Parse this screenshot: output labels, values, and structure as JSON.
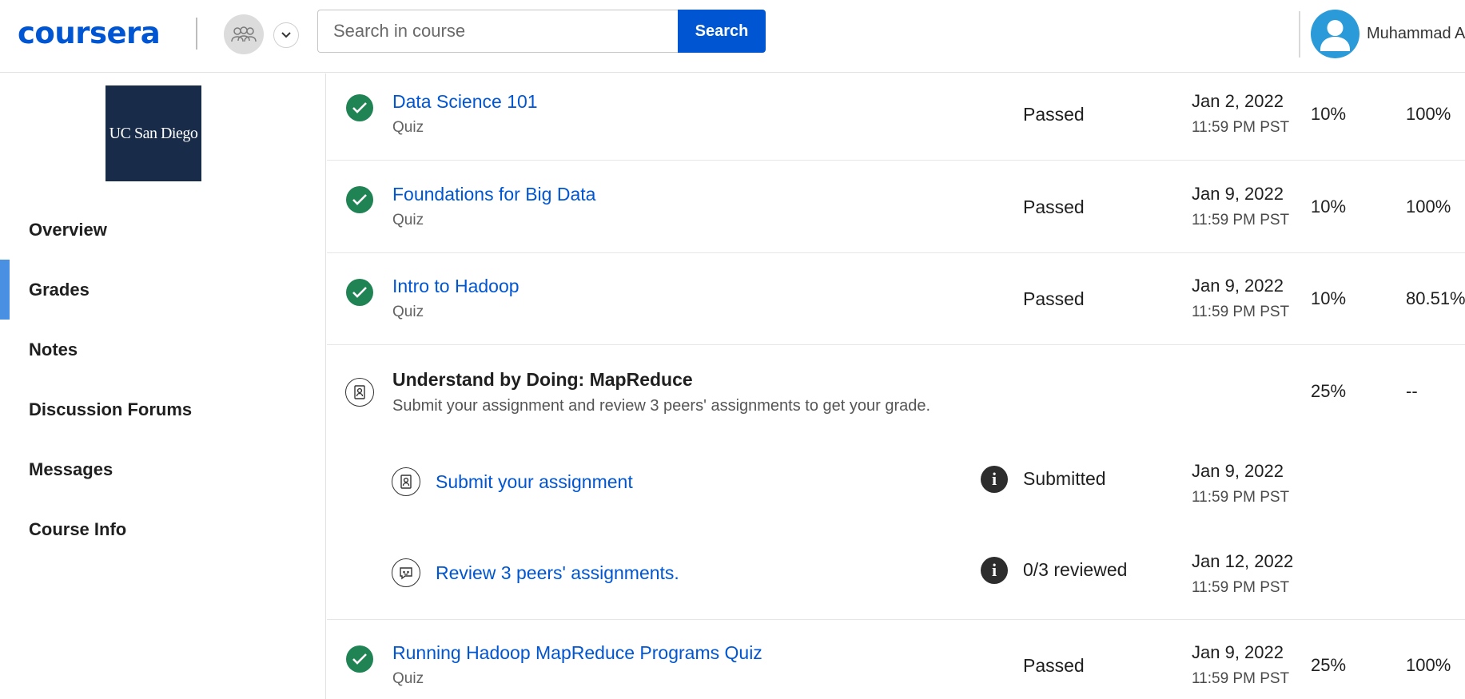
{
  "header": {
    "logo_text": "coursera",
    "search_placeholder": "Search in course",
    "search_button": "Search",
    "user_name": "Muhammad A"
  },
  "sidebar": {
    "school_logo_text": "UC San Diego",
    "items": [
      {
        "label": "Overview",
        "active": false
      },
      {
        "label": "Grades",
        "active": true
      },
      {
        "label": "Notes",
        "active": false
      },
      {
        "label": "Discussion Forums",
        "active": false
      },
      {
        "label": "Messages",
        "active": false
      },
      {
        "label": "Course Info",
        "active": false
      }
    ]
  },
  "grades": {
    "rows": [
      {
        "title": "Data Science 101",
        "type": "Quiz",
        "status": "Passed",
        "due_date": "Jan 2, 2022",
        "due_time": "11:59 PM PST",
        "weight": "10%",
        "grade": "100%"
      },
      {
        "title": "Foundations for Big Data",
        "type": "Quiz",
        "status": "Passed",
        "due_date": "Jan 9, 2022",
        "due_time": "11:59 PM PST",
        "weight": "10%",
        "grade": "100%"
      },
      {
        "title": "Intro to Hadoop",
        "type": "Quiz",
        "status": "Passed",
        "due_date": "Jan 9, 2022",
        "due_time": "11:59 PM PST",
        "weight": "10%",
        "grade": "80.51%"
      }
    ],
    "peer_assignment": {
      "title": "Understand by Doing: MapReduce",
      "description": "Submit your assignment and review 3 peers' assignments to get your grade.",
      "weight": "25%",
      "grade": "--",
      "subitems": [
        {
          "title": "Submit your assignment",
          "status": "Submitted",
          "due_date": "Jan 9, 2022",
          "due_time": "11:59 PM PST"
        },
        {
          "title": "Review 3 peers' assignments.",
          "status": "0/3 reviewed",
          "due_date": "Jan 12, 2022",
          "due_time": "11:59 PM PST"
        }
      ]
    },
    "last_row": {
      "title": "Running Hadoop MapReduce Programs Quiz",
      "type": "Quiz",
      "status": "Passed",
      "due_date": "Jan 9, 2022",
      "due_time": "11:59 PM PST",
      "weight": "25%",
      "grade": "100%"
    }
  },
  "colors": {
    "brand": "#0056d2",
    "passed_check": "#1f8354",
    "active_nav_bar": "#4a90e2",
    "school_logo_bg": "#182b49"
  }
}
